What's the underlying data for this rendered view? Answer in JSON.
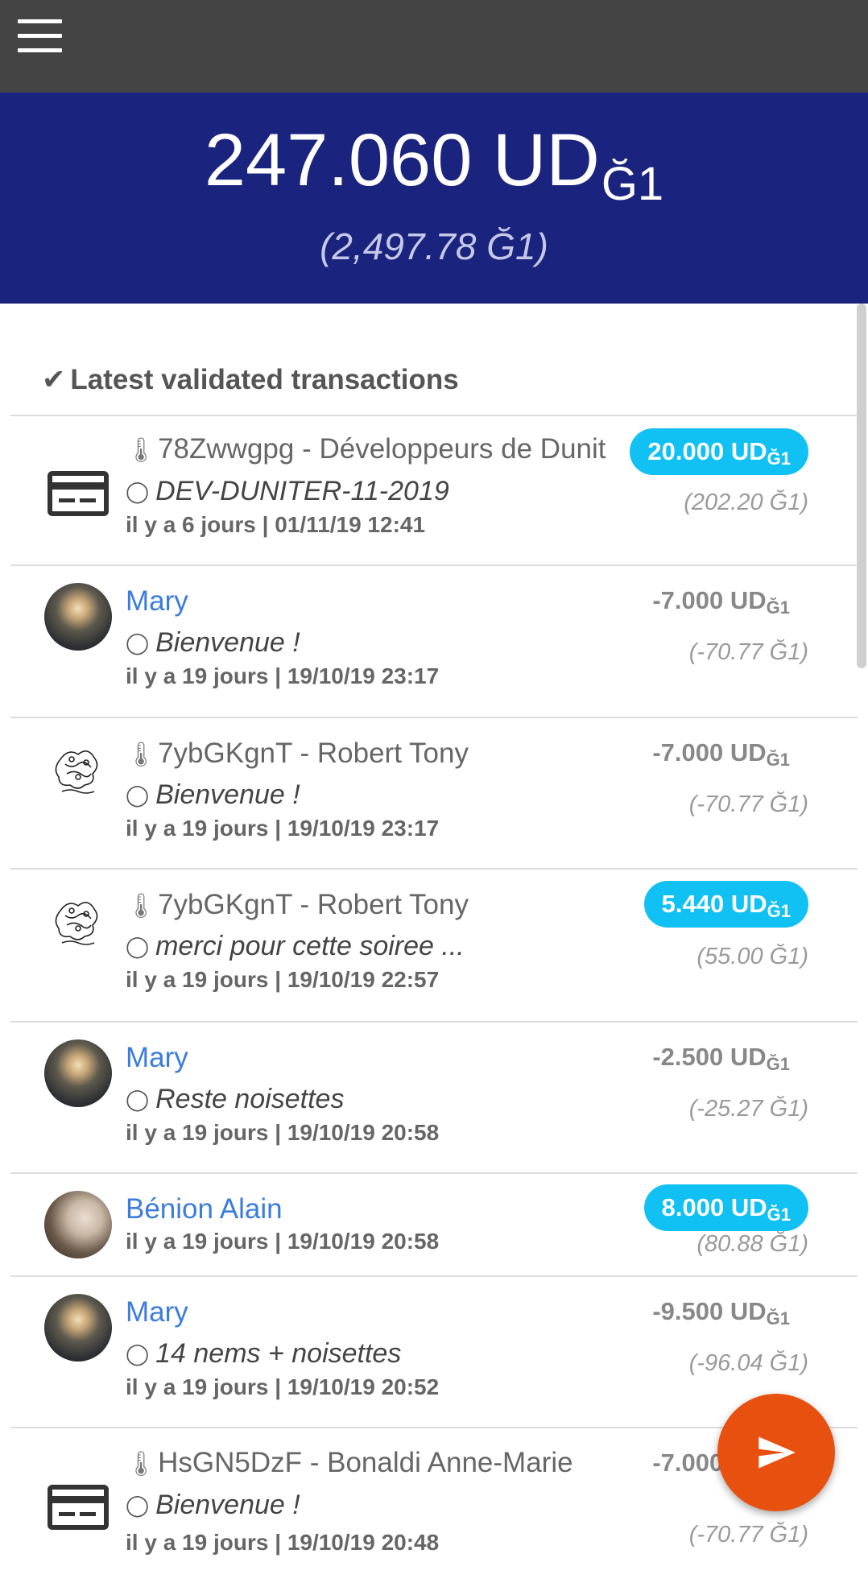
{
  "toolbar": {
    "menu_icon": "hamburger-menu-icon"
  },
  "wallet": {
    "balance_main": "247.060 UD",
    "balance_unit_sub": "Ğ1",
    "balance_converted": "(2,497.78 Ğ1)"
  },
  "colors": {
    "topbar": "#444444",
    "header": "#1a237e",
    "positive_badge": "#11c1f3",
    "member_name": "#3b7ddd",
    "fab": "#e8500f"
  },
  "history": {
    "section_title": "Latest validated transactions",
    "check_icon": "check-icon",
    "transactions": [
      {
        "avatar": "card-icon",
        "name": "78Zwwgpg - Développeurs de Dunit",
        "is_pubkey": true,
        "comment": "DEV-DUNITER-11-2019",
        "date": "il y a 6 jours | 01/11/19 12:41",
        "amount": "20.000 UD",
        "unit": "Ğ1",
        "positive": true,
        "converted": "(202.20 Ğ1)"
      },
      {
        "avatar": "photo",
        "name": "Mary",
        "is_pubkey": false,
        "comment": "Bienvenue !",
        "date": "il y a 19 jours | 19/10/19 23:17",
        "amount": "-7.000 UD",
        "unit": "Ğ1",
        "positive": false,
        "converted": "(-70.77 Ğ1)"
      },
      {
        "avatar": "sketch",
        "name": "7ybGKgnT - Robert Tony",
        "is_pubkey": true,
        "comment": "Bienvenue !",
        "date": "il y a 19 jours | 19/10/19 23:17",
        "amount": "-7.000 UD",
        "unit": "Ğ1",
        "positive": false,
        "converted": "(-70.77 Ğ1)"
      },
      {
        "avatar": "sketch",
        "name": "7ybGKgnT - Robert Tony",
        "is_pubkey": true,
        "comment": "merci pour cette soiree ...",
        "date": "il y a 19 jours | 19/10/19 22:57",
        "amount": "5.440 UD",
        "unit": "Ğ1",
        "positive": true,
        "converted": "(55.00 Ğ1)"
      },
      {
        "avatar": "photo",
        "name": "Mary",
        "is_pubkey": false,
        "comment": "Reste noisettes",
        "date": "il y a 19 jours | 19/10/19 20:58",
        "amount": "-2.500 UD",
        "unit": "Ğ1",
        "positive": false,
        "converted": "(-25.27 Ğ1)"
      },
      {
        "avatar": "photo",
        "name": "Bénion Alain",
        "is_pubkey": false,
        "comment": "",
        "date": "il y a 19 jours | 19/10/19 20:58",
        "amount": "8.000 UD",
        "unit": "Ğ1",
        "positive": true,
        "converted": "(80.88 Ğ1)"
      },
      {
        "avatar": "photo",
        "name": "Mary",
        "is_pubkey": false,
        "comment": "14 nems + noisettes",
        "date": "il y a 19 jours | 19/10/19 20:52",
        "amount": "-9.500 UD",
        "unit": "Ğ1",
        "positive": false,
        "converted": "(-96.04 Ğ1)"
      },
      {
        "avatar": "card-icon",
        "name": "HsGN5DzF - Bonaldi Anne-Marie",
        "is_pubkey": true,
        "comment": "Bienvenue !",
        "date": "il y a 19 jours | 19/10/19 20:48",
        "amount": "-7.000 UD",
        "unit": "Ğ1",
        "positive": false,
        "converted": "(-70.77 Ğ1)"
      }
    ]
  },
  "fab": {
    "icon": "send-icon"
  }
}
